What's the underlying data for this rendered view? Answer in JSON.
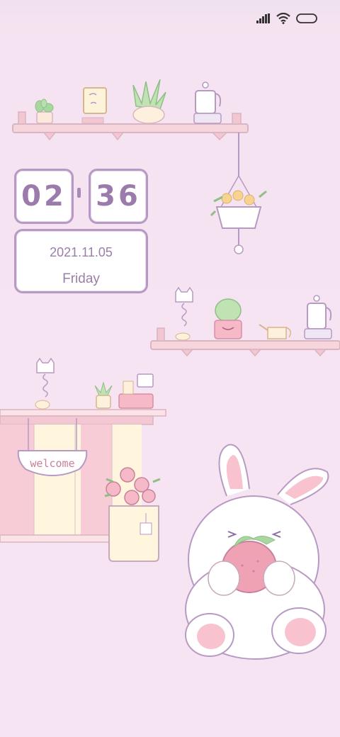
{
  "status_bar": {
    "icons": [
      "signal-icon",
      "wifi-icon",
      "battery-icon"
    ]
  },
  "clock": {
    "hours": "02",
    "minutes": "36",
    "date": "2021.11.05",
    "day": "Friday"
  },
  "wallpaper": {
    "sign_text": "welcome",
    "colors": {
      "background": "#f7e4f2",
      "accent": "#b79ac3",
      "shelf": "#f2cfd8",
      "pink": "#f5b9c8"
    }
  }
}
